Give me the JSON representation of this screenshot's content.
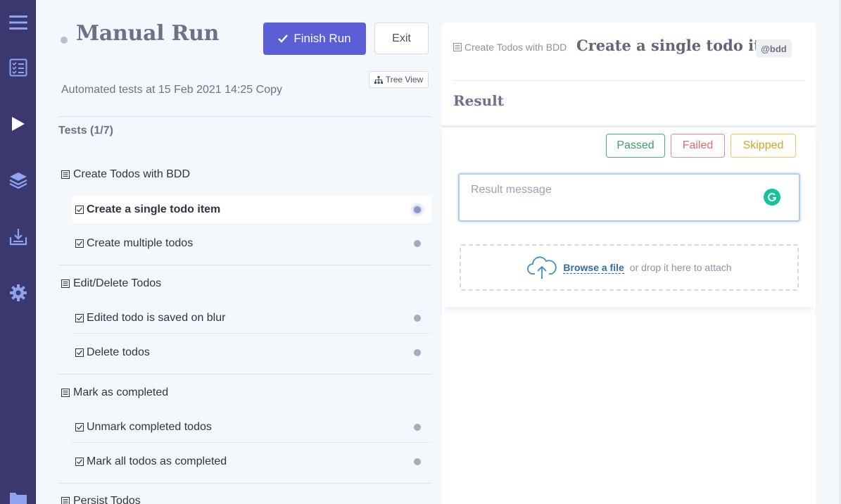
{
  "sidebar": {
    "items": [
      {
        "icon": "menu-icon"
      },
      {
        "icon": "test-list-icon"
      },
      {
        "icon": "play-icon"
      },
      {
        "icon": "layers-icon"
      },
      {
        "icon": "import-icon"
      },
      {
        "icon": "gear-icon"
      },
      {
        "icon": "folder-icon"
      }
    ]
  },
  "run": {
    "title": "Manual Run",
    "finish_label": "Finish Run",
    "exit_label": "Exit",
    "tree_view_label": "Tree View",
    "subtitle": "Automated tests at 15 Feb 2021 14:25",
    "copy_label": "Copy",
    "tests_count": "Tests (1/7)"
  },
  "suites": [
    {
      "name": "Create Todos with BDD",
      "tests": [
        {
          "name": "Create a single todo item",
          "active": true
        },
        {
          "name": "Create multiple todos",
          "active": false
        }
      ]
    },
    {
      "name": "Edit/Delete Todos",
      "tests": [
        {
          "name": "Edited todo is saved on blur",
          "active": false
        },
        {
          "name": "Delete todos",
          "active": false
        }
      ]
    },
    {
      "name": "Mark as completed",
      "tests": [
        {
          "name": "Unmark completed todos",
          "active": false
        },
        {
          "name": "Mark all todos as completed",
          "active": false
        }
      ]
    },
    {
      "name": "Persist Todos",
      "tests": []
    }
  ],
  "detail": {
    "suite_crumb": "Create Todos with BDD",
    "title": "Create a single todo item",
    "tag": "@bdd",
    "result_heading": "Result",
    "statuses": {
      "passed": "Passed",
      "failed": "Failed",
      "skipped": "Skipped"
    },
    "message_placeholder": "Result message",
    "browse_label": "Browse a file",
    "drop_hint": "or drop it here to attach"
  },
  "colors": {
    "rail_bg": "#3b3870",
    "primary": "#5b5fd6",
    "passed": "#3f9e66",
    "failed": "#e06b6b",
    "skipped": "#d1a52c",
    "grammarly": "#15c39a"
  }
}
